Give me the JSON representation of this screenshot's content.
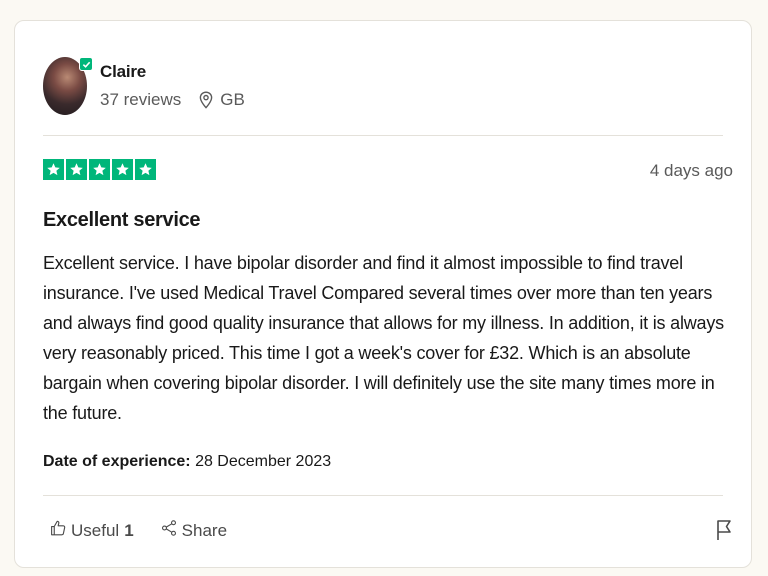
{
  "reviewer": {
    "name": "Claire",
    "reviews": "37 reviews",
    "country": "GB"
  },
  "review": {
    "rating": 5,
    "date_ago": "4 days ago",
    "title": "Excellent service",
    "body": "Excellent service. I have bipolar disorder and find it almost impossible to find travel insurance. I've used Medical Travel Compared several times over more than ten years and always find good quality insurance that allows for my illness. In addition, it is always very reasonably priced. This time I got a week's cover for £32. Which is an absolute bargain when covering bipolar disorder. I will definitely use the site many times more in the future.",
    "experience_label": "Date of experience:",
    "experience_date": "28 December 2023"
  },
  "actions": {
    "useful_label": "Useful",
    "useful_count": "1",
    "share_label": "Share"
  },
  "colors": {
    "star_green": "#00b67a",
    "background": "#fbf9f3"
  },
  "icons": [
    "verified-badge-icon",
    "location-pin-icon",
    "star-icon",
    "thumbs-up-icon",
    "share-icon",
    "flag-icon"
  ]
}
